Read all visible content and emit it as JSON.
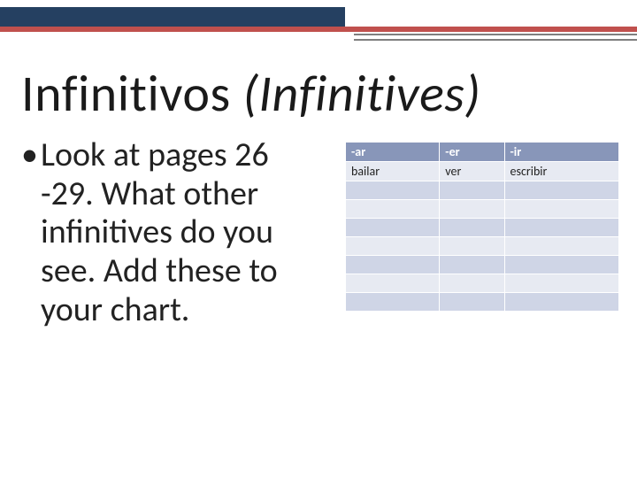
{
  "title": {
    "main": "Infinitivos ",
    "italic": "(Infinitives)"
  },
  "bullet": "Look at pages 26 -29. What other infinitives do you see. Add these to your chart.",
  "table": {
    "headers": [
      "-ar",
      "-er",
      "-ir"
    ],
    "rows": [
      [
        "bailar",
        "ver",
        "escribir"
      ],
      [
        "",
        "",
        ""
      ],
      [
        "",
        "",
        ""
      ],
      [
        "",
        "",
        ""
      ],
      [
        "",
        "",
        ""
      ],
      [
        "",
        "",
        ""
      ],
      [
        "",
        "",
        ""
      ],
      [
        "",
        "",
        ""
      ]
    ]
  }
}
